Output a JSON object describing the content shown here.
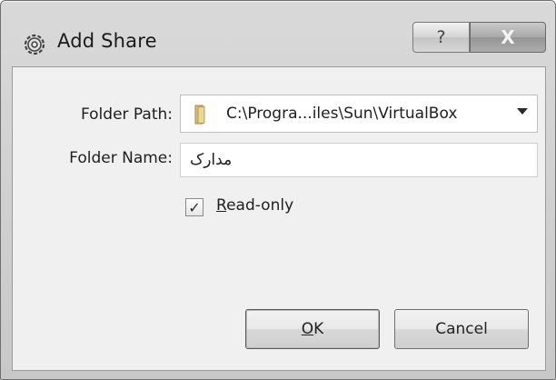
{
  "window": {
    "title": "Add Share",
    "help_glyph": "?",
    "close_glyph": "X",
    "icon": "gear-icon"
  },
  "form": {
    "folder_path_label": "Folder Path:",
    "folder_path_value": "C:\\Progra...iles\\Sun\\VirtualBox",
    "folder_name_label": "Folder Name:",
    "folder_name_value": "مدارک",
    "readonly_mnemonic": "R",
    "readonly_rest": "ead-only",
    "readonly_checked": true,
    "check_glyph": "✓"
  },
  "buttons": {
    "ok_mnemonic": "O",
    "ok_rest": "K",
    "cancel_label": "Cancel"
  }
}
